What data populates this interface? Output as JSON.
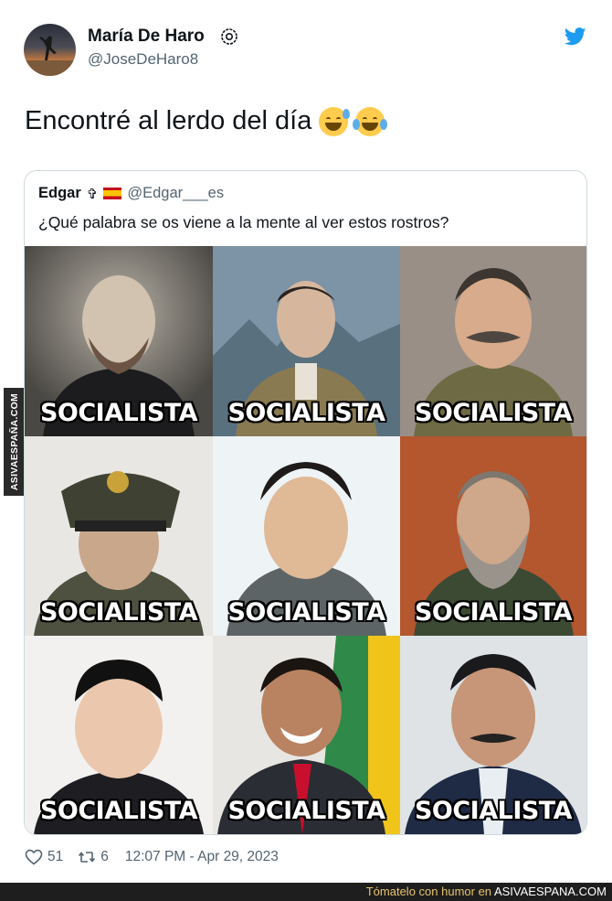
{
  "watermark": {
    "side_text": "ASIVAESPAÑA.COM"
  },
  "tweet": {
    "author_name": "María De Haro",
    "author_handle": "@JoseDeHaro8",
    "text": "Encontré al lerdo del día",
    "emojis": [
      "sweat-smile-emoji",
      "joy-emoji"
    ],
    "likes": "51",
    "retweets": "6",
    "timestamp": "12:07 PM - Apr 29, 2023"
  },
  "quoted_tweet": {
    "author_name": "Edgar",
    "author_badges": [
      "latin-cross-icon",
      "spain-flag-icon"
    ],
    "author_handle": "@Edgar___es",
    "text": "¿Qué palabra se os viene a la mente al ver estos rostros?",
    "image_captions": [
      "SOCIALISTA",
      "SOCIALISTA",
      "SOCIALISTA",
      "SOCIALISTA",
      "SOCIALISTA",
      "SOCIALISTA",
      "SOCIALISTA",
      "SOCIALISTA",
      "SOCIALISTA"
    ]
  },
  "footer_bar": {
    "prefix": "Tómatelo con humor en ",
    "brand": "ASIVAESPANA.COM"
  },
  "colors": {
    "twitter_blue": "#1d9bf0",
    "muted_text": "#536471",
    "border": "#cfd9de"
  }
}
